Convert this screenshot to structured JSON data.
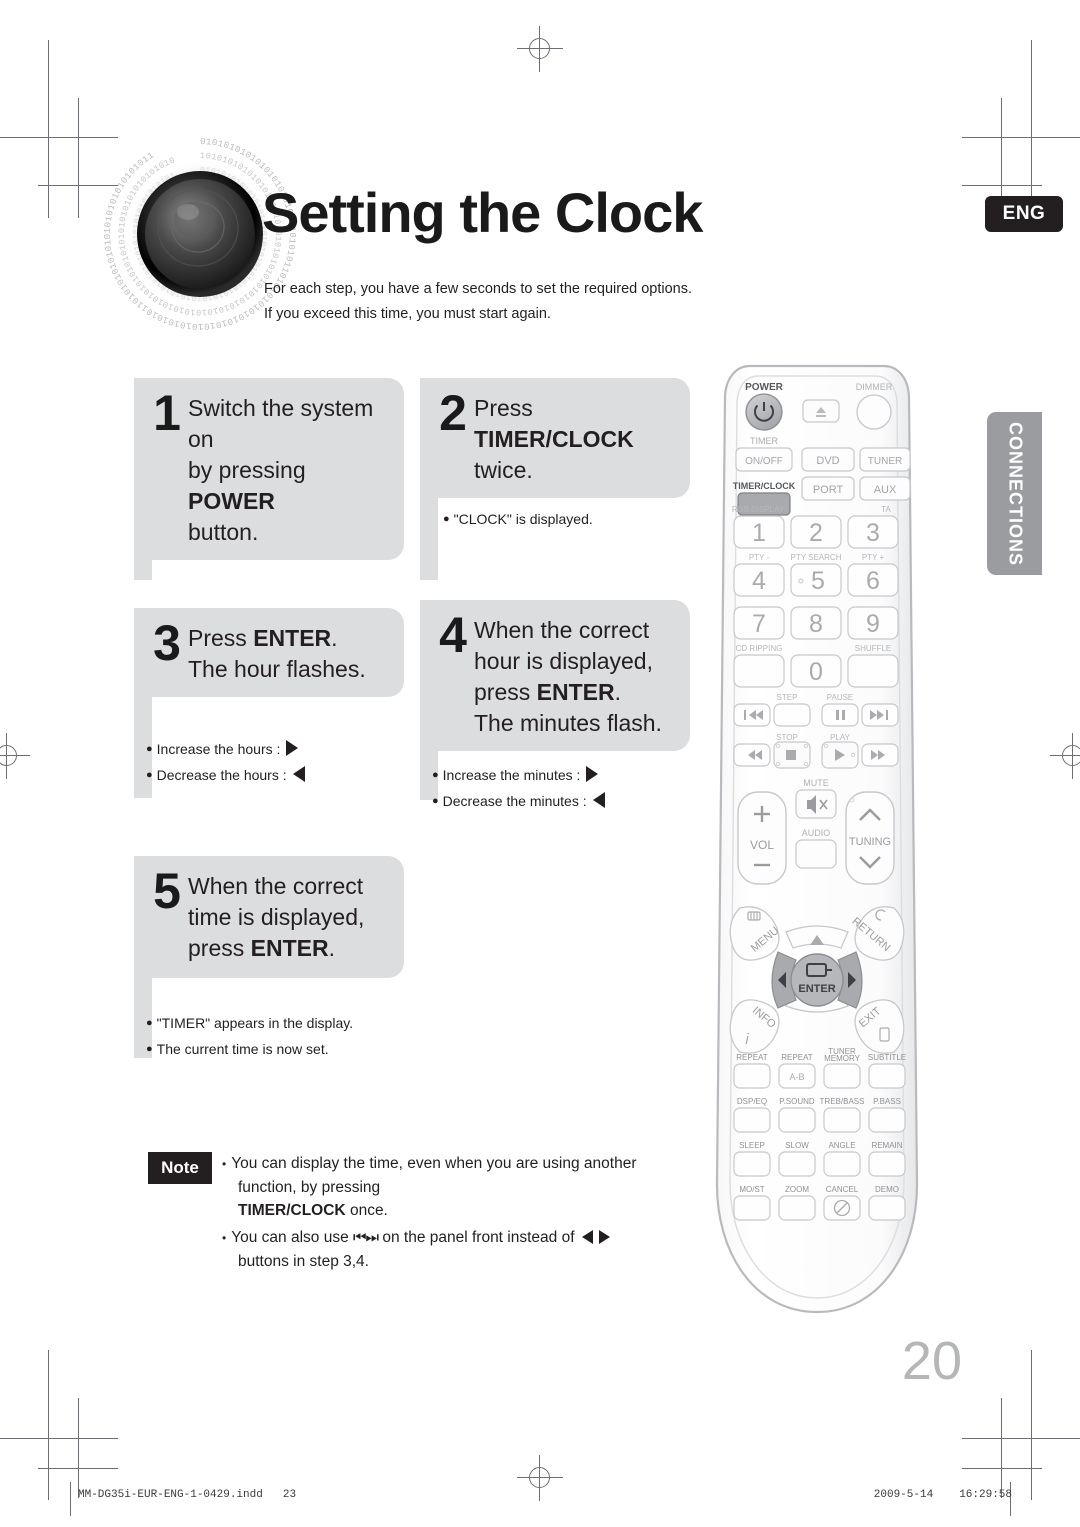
{
  "header": {
    "title": "Setting the Clock",
    "intro_line1": "For each step, you have a few seconds to set the required options.",
    "intro_line2": "If you exceed this time, you must start again.",
    "language_badge": "ENG",
    "logo_icon": "speaker-binary-icon"
  },
  "side_tab": {
    "label": "CONNECTIONS",
    "color": "#9a9ca0"
  },
  "steps": [
    {
      "number": "1",
      "text_parts": [
        {
          "t": "Switch the system on",
          "bold": false
        },
        {
          "t": "by pressing ",
          "bold": false
        },
        {
          "t": "POWER",
          "bold": true
        },
        {
          "t": "button.",
          "bold": false
        }
      ],
      "bullets": []
    },
    {
      "number": "2",
      "text_parts": [
        {
          "t": "Press ",
          "bold": false
        },
        {
          "t": "TIMER/CLOCK",
          "bold": true
        },
        {
          "t": "twice.",
          "bold": false
        }
      ],
      "bullets": [
        {
          "label": "\"CLOCK\" is displayed.",
          "arrow": ""
        }
      ]
    },
    {
      "number": "3",
      "text_parts": [
        {
          "t": "Press ",
          "bold": false
        },
        {
          "t": "ENTER",
          "bold": true
        },
        {
          "t": ".",
          "bold": false
        },
        {
          "t": "The hour flashes.",
          "bold": false
        }
      ],
      "bullets": [
        {
          "label": "Increase the hours :",
          "arrow": "right"
        },
        {
          "label": "Decrease the hours :",
          "arrow": "left"
        }
      ]
    },
    {
      "number": "4",
      "text_parts": [
        {
          "t": "When the correct",
          "bold": false
        },
        {
          "t": "hour is displayed,",
          "bold": false
        },
        {
          "t": "press ",
          "bold": false
        },
        {
          "t": "ENTER",
          "bold": true
        },
        {
          "t": ".",
          "bold": false
        },
        {
          "t": "The minutes flash.",
          "bold": false
        }
      ],
      "bullets": [
        {
          "label": "Increase the minutes :",
          "arrow": "right"
        },
        {
          "label": "Decrease the minutes :",
          "arrow": "left"
        }
      ]
    },
    {
      "number": "5",
      "text_parts": [
        {
          "t": "When the correct",
          "bold": false
        },
        {
          "t": "time is displayed,",
          "bold": false
        },
        {
          "t": "press ",
          "bold": false
        },
        {
          "t": "ENTER",
          "bold": true
        },
        {
          "t": ".",
          "bold": false
        }
      ],
      "bullets": [
        {
          "label": "\"TIMER\" appears in the display.",
          "arrow": ""
        },
        {
          "label": "The current time is now set.",
          "arrow": ""
        }
      ]
    }
  ],
  "step_text": {
    "s1_l1": "Switch the system on",
    "s1_l2a": "by pressing ",
    "s1_l2b": "POWER",
    "s1_l3": "button.",
    "s2_l1a": "Press ",
    "s2_l1b": "TIMER/CLOCK",
    "s2_l2": "twice.",
    "s3_l1a": "Press ",
    "s3_l1b": "ENTER",
    "s3_l1c": ".",
    "s3_l2": "The hour flashes.",
    "s4_l1": "When the correct",
    "s4_l2": "hour is displayed,",
    "s4_l3a": "press ",
    "s4_l3b": "ENTER",
    "s4_l3c": ".",
    "s4_l4": "The minutes flash.",
    "s5_l1": "When the correct",
    "s5_l2": "time is displayed,",
    "s5_l3a": "press ",
    "s5_l3b": "ENTER",
    "s5_l3c": "."
  },
  "step_bullets": {
    "b2_1": "\"CLOCK\" is displayed.",
    "b3_1": "Increase the hours :",
    "b3_2": "Decrease the hours :",
    "b4_1": "Increase the minutes :",
    "b4_2": "Decrease the minutes :",
    "b5_1": "\"TIMER\" appears in the display.",
    "b5_2": "The current time is now set."
  },
  "note": {
    "badge": "Note",
    "item1_a": "You can display the time, even when you are using another",
    "item1_b": "function, by pressing",
    "item1_c": "TIMER/CLOCK",
    "item1_d": " once.",
    "item2_a": "You can also use",
    "item2_skip": "⏮⏭",
    "item2_b": "on the panel front instead of",
    "item2_c": "buttons in step 3,4."
  },
  "page_number": "20",
  "footer": {
    "filename": "MM-DG35i-EUR-ENG-1-0429.indd",
    "page": "23",
    "date": "2009-5-14",
    "time": "16:29:58"
  },
  "remote": {
    "power_label": "POWER",
    "dimmer_label": "DIMMER",
    "eject_icon": "eject-icon",
    "timer_label": "TIMER",
    "onoff_label": "ON/OFF",
    "timerclock_label": "TIMER/CLOCK",
    "source_buttons": [
      "DVD",
      "TUNER",
      "PORT",
      "AUX"
    ],
    "rds_display_label": "RDS DISPLAY",
    "ta_label": "TA",
    "pty_minus_label": "PTY -",
    "pty_search_label": "PTY SEARCH",
    "pty_plus_label": "PTY +",
    "numbers": [
      "1",
      "2",
      "3",
      "4",
      "5",
      "6",
      "7",
      "8",
      "9",
      "0"
    ],
    "cd_ripping_label": "CD RIPPING",
    "shuffle_label": "SHUFFLE",
    "step_label": "STEP",
    "pause_label": "PAUSE",
    "stop_label": "STOP",
    "play_label": "PLAY",
    "vol_label": "VOL",
    "mute_label": "MUTE",
    "audio_label": "AUDIO",
    "tuning_label": "TUNING",
    "menu_label": "MENU",
    "return_label": "RETURN",
    "enter_label": "ENTER",
    "info_label": "INFO",
    "exit_label": "EXIT",
    "grid_row1": [
      "REPEAT",
      "REPEAT",
      "TUNER MEMORY",
      "SUBTITLE"
    ],
    "ab_label": "A-B",
    "grid_row2": [
      "DSP/EQ",
      "P.SOUND",
      "TREB/BASS",
      "P.BASS"
    ],
    "grid_row3": [
      "SLEEP",
      "SLOW",
      "ANGLE",
      "REMAIN"
    ],
    "grid_row4": [
      "MO/ST",
      "ZOOM",
      "CANCEL",
      "DEMO"
    ]
  }
}
